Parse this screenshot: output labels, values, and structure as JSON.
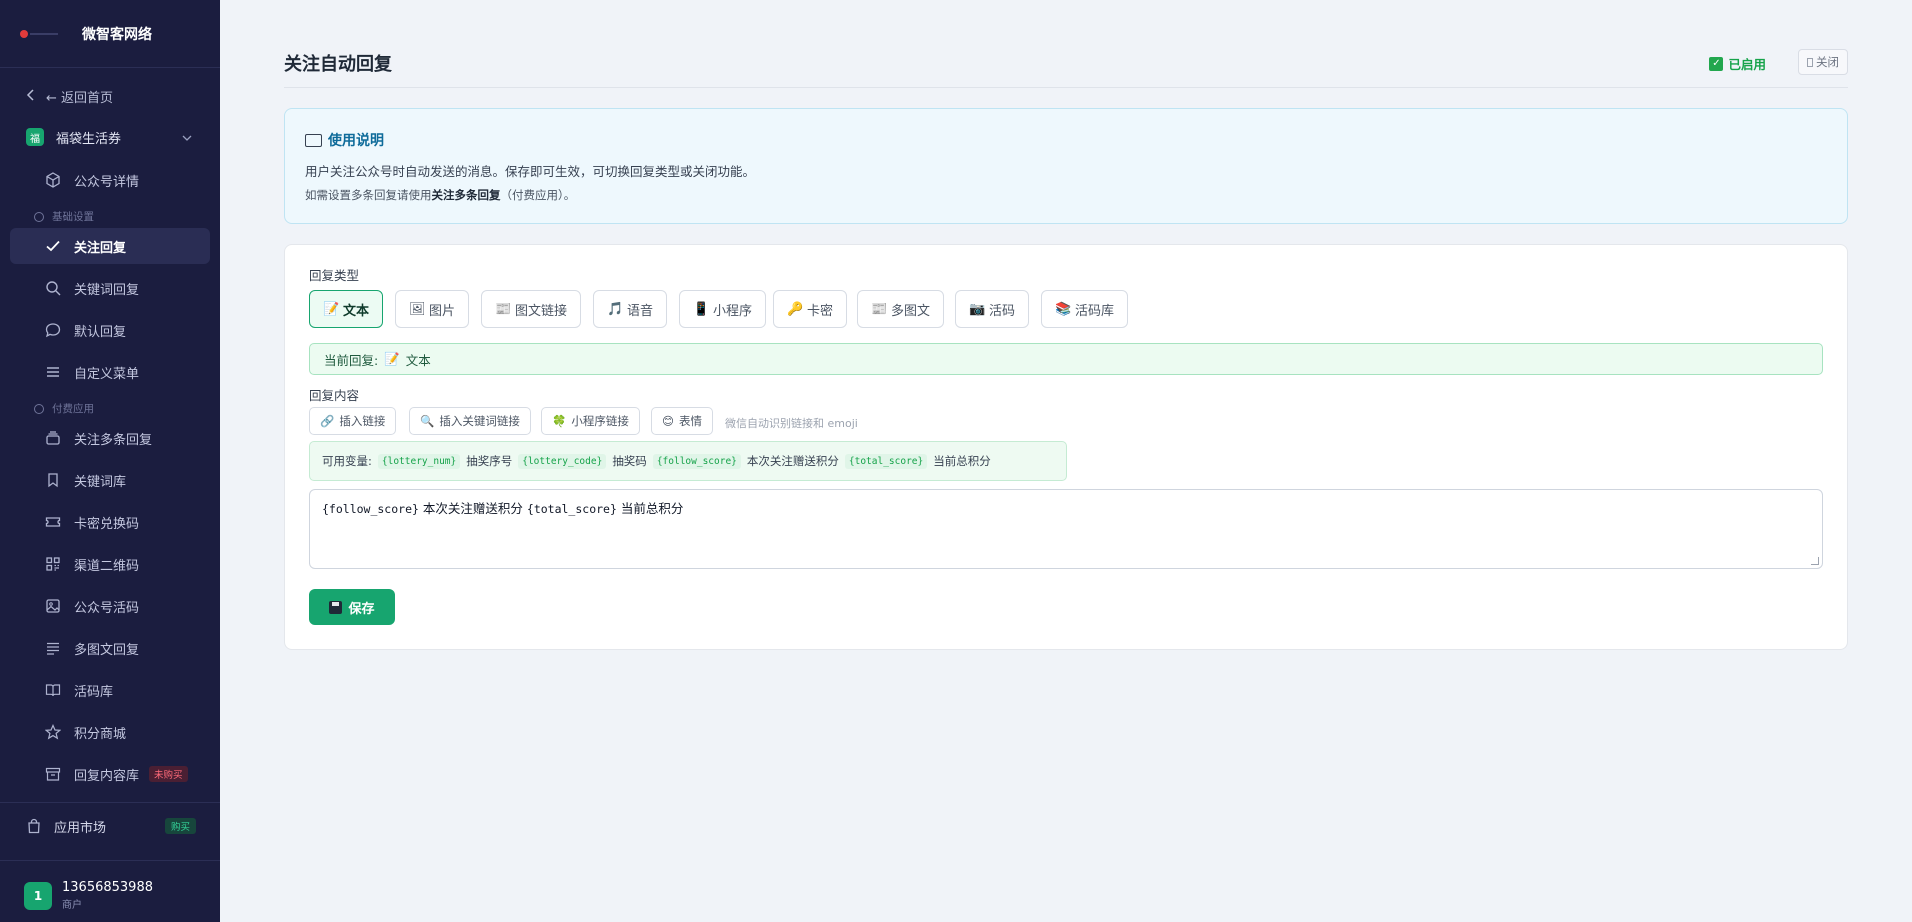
{
  "sidebar": {
    "brand": "微智客网络",
    "back_label": "← 返回首页",
    "account": {
      "badge": "福",
      "name": "福袋生活券"
    },
    "items": [
      {
        "label": "公众号详情",
        "icon": "cube-icon"
      },
      {
        "section": "基础设置"
      },
      {
        "label": "关注回复",
        "icon": "check-icon",
        "active": true
      },
      {
        "label": "关键词回复",
        "icon": "search-icon"
      },
      {
        "label": "默认回复",
        "icon": "chat-icon"
      },
      {
        "label": "自定义菜单",
        "icon": "menu-icon"
      },
      {
        "section": "付费应用"
      },
      {
        "label": "关注多条回复",
        "icon": "stack-icon"
      },
      {
        "label": "关键词库",
        "icon": "bookmark-icon"
      },
      {
        "label": "卡密兑换码",
        "icon": "ticket-icon"
      },
      {
        "label": "渠道二维码",
        "icon": "qrcode-icon"
      },
      {
        "label": "公众号活码",
        "icon": "image-icon"
      },
      {
        "label": "多图文回复",
        "icon": "list-icon"
      },
      {
        "label": "活码库",
        "icon": "book-icon"
      },
      {
        "label": "积分商城",
        "icon": "star-icon"
      },
      {
        "label": "回复内容库",
        "icon": "archive-icon",
        "tag": "未购买"
      }
    ],
    "market": {
      "label": "应用市场",
      "tag": "购买"
    },
    "user": {
      "avatar": "1",
      "phone": "13656853988",
      "role": "商户"
    }
  },
  "header": {
    "title": "关注自动回复",
    "status": "已启用",
    "close_label": "关闭"
  },
  "usage": {
    "title": "使用说明",
    "line1": "用户关注公众号时自动发送的消息。保存即可生效，可切换回复类型或关闭功能。",
    "line2_prefix": "如需设置多条回复请使用",
    "line2_bold": "关注多条回复",
    "line2_suffix": "（付费应用）。"
  },
  "form": {
    "type_label": "回复类型",
    "types": [
      {
        "label": "文本",
        "icon": "📝",
        "active": true
      },
      {
        "label": "图片",
        "icon": "🖼"
      },
      {
        "label": "图文链接",
        "icon": "📰"
      },
      {
        "label": "语音",
        "icon": "🎵"
      },
      {
        "label": "小程序",
        "icon": "📱"
      },
      {
        "label": "卡密",
        "icon": "🔑"
      },
      {
        "label": "多图文",
        "icon": "📰"
      },
      {
        "label": "活码",
        "icon": "📷"
      },
      {
        "label": "活码库",
        "icon": "📚"
      }
    ],
    "current_prefix": "当前回复:",
    "current_icon": "📝",
    "current_value": "文本",
    "content_label": "回复内容",
    "tools": [
      {
        "label": "插入链接",
        "icon": "🔗"
      },
      {
        "label": "插入关键词链接",
        "icon": "🔍"
      },
      {
        "label": "小程序链接",
        "icon": "🍀"
      },
      {
        "label": "表情",
        "icon": "😊"
      }
    ],
    "tool_hint": "微信自动识别链接和 emoji",
    "vars_label": "可用变量:",
    "vars": [
      {
        "code": "{lottery_num}",
        "desc": "抽奖序号"
      },
      {
        "code": "{lottery_code}",
        "desc": "抽奖码"
      },
      {
        "code": "{follow_score}",
        "desc": "本次关注赠送积分"
      },
      {
        "code": "{total_score}",
        "desc": "当前总积分"
      }
    ],
    "content": {
      "v1": "{follow_score}",
      "t1": " 本次关注赠送积分 ",
      "v2": "{total_score}",
      "t2": " 当前总积分"
    },
    "save_label": "保存"
  },
  "colors": {
    "sidebar_bg": "#1b1d3f",
    "accent": "#17a56f",
    "info_bg": "#eef8fd"
  }
}
